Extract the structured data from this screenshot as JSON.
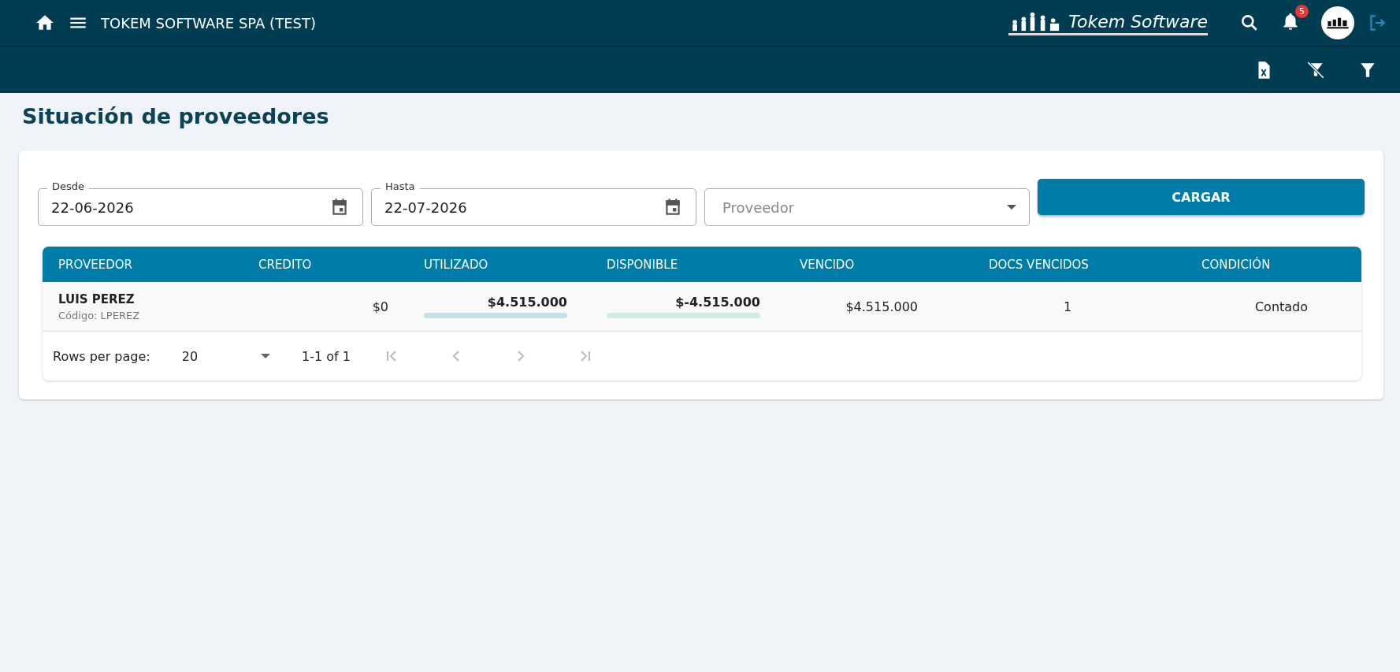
{
  "topbar": {
    "company": "TOKEM SOFTWARE SPA (TEST)",
    "logo_text": "Tokem Software",
    "notifications": "5"
  },
  "page_title": "Situación de proveedores",
  "filters": {
    "desde": {
      "label": "Desde",
      "value": "22-06-2026"
    },
    "hasta": {
      "label": "Hasta",
      "value": "22-07-2026"
    },
    "proveedor": {
      "placeholder": "Proveedor"
    },
    "button": "CARGAR"
  },
  "table": {
    "columns": [
      "PROVEEDOR",
      "CREDITO",
      "UTILIZADO",
      "DISPONIBLE",
      "VENCIDO",
      "DOCS VENCIDOS",
      "CONDICIÓN"
    ],
    "rows": [
      {
        "name": "LUIS PEREZ",
        "code": "Código: LPEREZ",
        "credito": "$0",
        "utilizado": {
          "value": "$4.515.000",
          "level": 1
        },
        "disponible": {
          "value": "$-4.515.000",
          "level": 1
        },
        "vencido": "$4.515.000",
        "docs": "1",
        "condicion": "Contado"
      }
    ]
  },
  "pagination": {
    "rows_label": "Rows per page:",
    "rows_value": "20",
    "range": "1-1 of 1"
  }
}
